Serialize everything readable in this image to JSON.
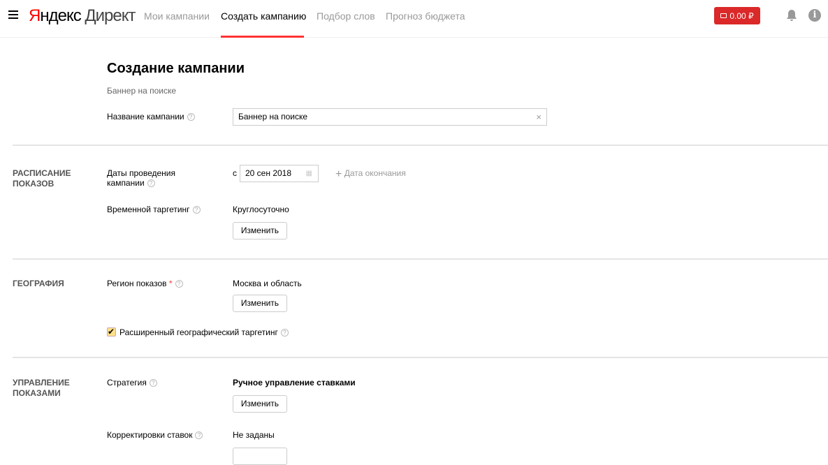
{
  "header": {
    "logo_brand": "Я",
    "logo_rest": "ндекс",
    "logo_product": "Директ",
    "nav": [
      "Мои кампании",
      "Создать кампанию",
      "Подбор слов",
      "Прогноз бюджета"
    ],
    "balance": "0.00 ₽"
  },
  "page": {
    "title": "Создание кампании",
    "subtitle": "Баннер на поиске"
  },
  "name_field": {
    "label": "Название кампании",
    "value": "Баннер на поиске"
  },
  "schedule": {
    "section": [
      "РАСПИСАНИЕ",
      "ПОКАЗОВ"
    ],
    "dates_label": [
      "Даты проведения",
      "кампании"
    ],
    "from": "с",
    "start_date": "20 сен 2018",
    "end_date_link": "Дата окончания",
    "time_label": "Временной таргетинг",
    "time_value": "Круглосуточно",
    "change": "Изменить"
  },
  "geo": {
    "section": "ГЕОГРАФИЯ",
    "region_label": "Регион показов",
    "required": "*",
    "region_value": "Москва и область",
    "change": "Изменить",
    "extended_label": "Расширенный географический таргетинг"
  },
  "control": {
    "section": [
      "УПРАВЛЕНИЕ",
      "ПОКАЗАМИ"
    ],
    "strategy_label": "Стратегия",
    "strategy_value": "Ручное управление ставками",
    "change": "Изменить",
    "adjust_label": "Корректировки ставок",
    "adjust_value": "Не заданы"
  }
}
